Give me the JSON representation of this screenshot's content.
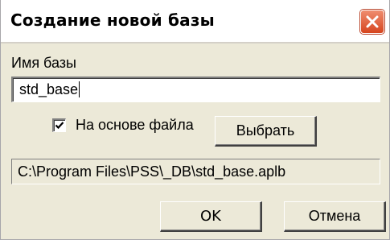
{
  "window": {
    "title": "Создание новой базы",
    "close_icon": "close-icon"
  },
  "form": {
    "name_label": "Имя базы",
    "name_value": "std_base",
    "file_based_checkbox": {
      "label": "На основе файла",
      "checked": true
    },
    "browse_label": "Выбрать",
    "path_value": "C:\\Program Files\\PSS\\_DB\\std_base.aplb"
  },
  "buttons": {
    "ok_label": "OK",
    "cancel_label": "Отмена"
  },
  "colors": {
    "dialog_background": "#ece9d8",
    "close_button": "#d6451f"
  }
}
